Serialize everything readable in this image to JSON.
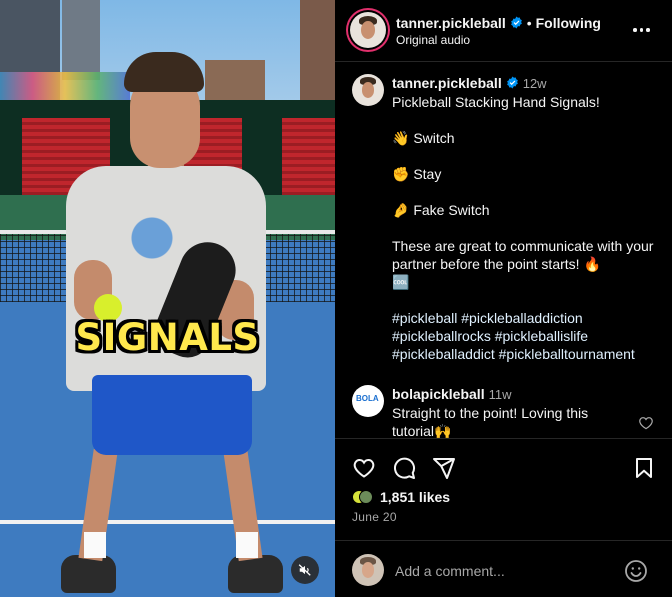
{
  "video": {
    "overlay_text": "SIGNALS",
    "mute_icon": "speaker-muted-icon"
  },
  "header": {
    "username": "tanner.pickleball",
    "verified_icon": "verified-badge-icon",
    "separator": "•",
    "follow_status": "Following",
    "audio_label": "Original audio",
    "more_icon": "more-options-icon"
  },
  "caption": {
    "username": "tanner.pickleball",
    "time_ago": "12w",
    "title": "Pickleball Stacking Hand Signals!",
    "signals": [
      {
        "emoji": "👋",
        "label": "Switch"
      },
      {
        "emoji": "✊",
        "label": "Stay"
      },
      {
        "emoji": "🤌",
        "label": "Fake Switch"
      }
    ],
    "body": "These are great to communicate with your partner before the point starts! 🔥",
    "body_extra": "🆒",
    "hashtags": "#pickleball #pickleballaddiction #pickleballrocks #pickleballislife #pickleballaddict #pickleballtournament"
  },
  "comment": {
    "avatar_text": "BOLA",
    "username": "bolapickleball",
    "time_ago": "11w",
    "text": "Straight to the point! Loving this tutorial🙌",
    "like_icon": "heart-outline-icon"
  },
  "actions": {
    "like_icon": "heart-icon",
    "comment_icon": "comment-icon",
    "share_icon": "share-icon",
    "save_icon": "bookmark-icon",
    "likes": "1,851 likes",
    "date": "June 20"
  },
  "add_comment": {
    "placeholder": "Add a comment...",
    "emoji_icon": "emoji-icon"
  },
  "colors": {
    "background": "#000000",
    "text": "#f5f5f5",
    "muted": "#a8a8a8",
    "verified": "#0095f6",
    "hashtag": "#e0f1ff",
    "caption_yellow": "#ffe84d"
  }
}
